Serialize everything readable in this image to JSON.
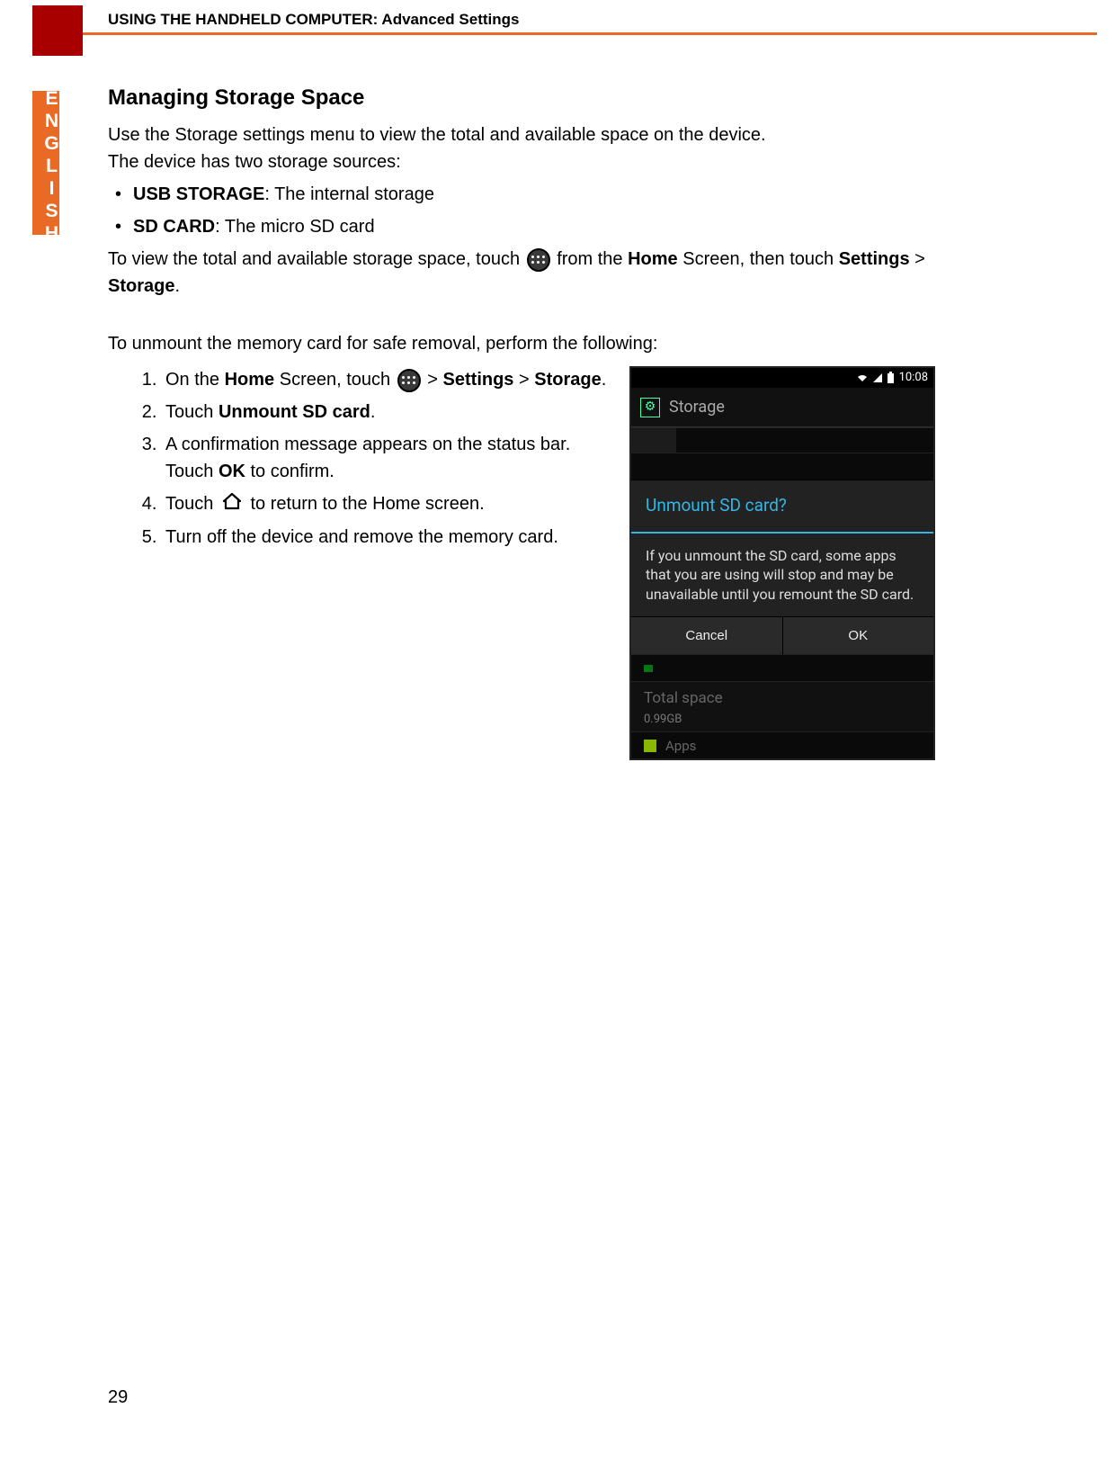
{
  "header": {
    "chapter": "USING THE HANDHELD COMPUTER: Advanced Settings"
  },
  "sidebar": {
    "language_tab": "ENGLISH"
  },
  "section": {
    "title": "Managing Storage Space",
    "intro_p1": "Use the Storage settings menu to view the total and available space on the device.",
    "intro_p2": "The device has two storage sources:",
    "bullets": [
      {
        "bold": "USB STORAGE",
        "rest": ": The internal storage"
      },
      {
        "bold": "SD CARD",
        "rest": ": The micro SD card"
      }
    ],
    "nav_pre": "To view the total and available storage space, touch ",
    "nav_mid": " from the ",
    "nav_home": "Home",
    "nav_post": " Screen, then touch ",
    "nav_b1": "Settings",
    "nav_gt": " > ",
    "nav_b2": "Storage",
    "nav_end": ".",
    "unmount_intro": "To unmount the memory card for safe removal, perform the following:",
    "steps": {
      "s1_a": "On the ",
      "s1_home": "Home",
      "s1_b": " Screen, touch ",
      "s1_gt": " > ",
      "s1_settings": "Settings",
      "s1_gt2": " > ",
      "s1_storage": "Storage",
      "s1_end": ".",
      "s2_a": "Touch ",
      "s2_b": "Unmount SD card",
      "s2_end": ".",
      "s3_a": "A confirmation message appears on the status bar. Touch ",
      "s3_ok": "OK",
      "s3_end": " to confirm.",
      "s4_a": "Touch ",
      "s4_end": " to return to the Home screen.",
      "s5": "Turn off the device and remove the memory card."
    }
  },
  "phone": {
    "time": "10:08",
    "page": "Storage",
    "dialog_title": "Unmount SD card?",
    "dialog_body": "If you unmount the SD card, some apps that you are using will stop and may be unavailable until you remount the SD card.",
    "cancel": "Cancel",
    "ok": "OK",
    "total_space": "Total space",
    "total_value": "0.99GB",
    "apps_label": "Apps"
  },
  "page_number": "29"
}
